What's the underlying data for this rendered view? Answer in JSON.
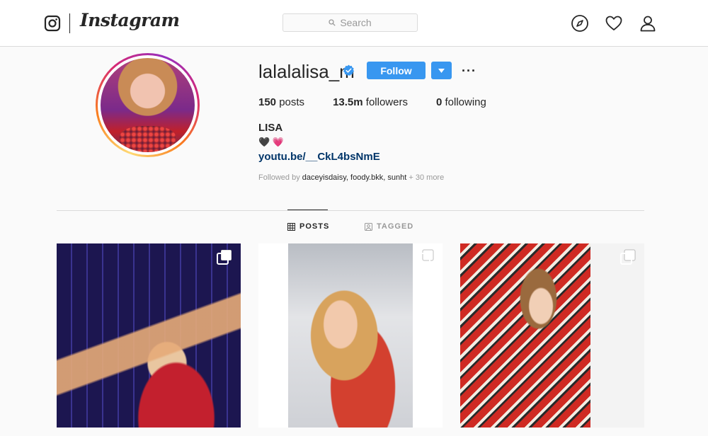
{
  "nav": {
    "brand": "Instagram",
    "search_placeholder": "Search",
    "icons": [
      "instagram-glyph-icon",
      "compass-icon",
      "heart-icon",
      "profile-icon"
    ]
  },
  "profile": {
    "username": "lalalalisa_m",
    "verified": true,
    "follow_label": "Follow",
    "more_label": "···",
    "stats": {
      "posts_count": "150",
      "posts_label": "posts",
      "followers_count": "13.5m",
      "followers_label": "followers",
      "following_count": "0",
      "following_label": "following"
    },
    "full_name": "LISA",
    "bio_emoji": "🖤 💗",
    "link": "youtu.be/__CkL4bsNmE",
    "followed_by_prefix": "Followed by ",
    "followed_by_names": "daceyisdaisy, foody.bkk, sunht",
    "followed_by_more": " + 30 more"
  },
  "tabs": {
    "posts": "POSTS",
    "tagged": "TAGGED"
  },
  "colors": {
    "accent": "#3897f0",
    "link": "#003569",
    "border": "#dbdbdb",
    "background": "#fafafa"
  }
}
